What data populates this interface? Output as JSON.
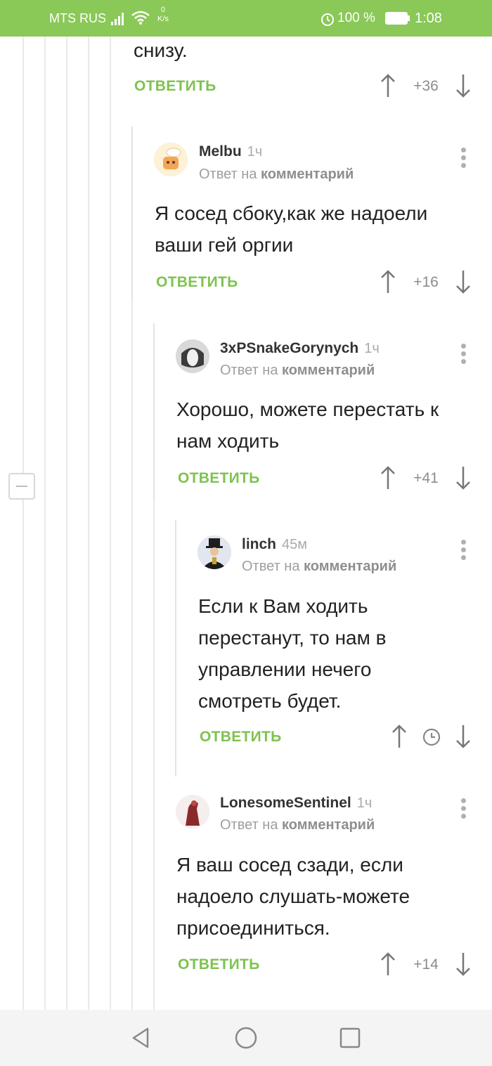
{
  "status_bar": {
    "carrier": "MTS RUS",
    "speed_value": "0",
    "speed_unit": "K/s",
    "battery": "100 %",
    "time": "1:08",
    "icons": [
      "signal-icon",
      "wifi-icon",
      "alarm-icon",
      "battery-icon"
    ]
  },
  "top_fragment": {
    "text_tail": "снизу.",
    "reply_label": "ОТВЕТИТЬ",
    "score": "+36"
  },
  "comments": [
    {
      "author": "Melbu",
      "time": "1ч",
      "reply_prefix": "Ответ на",
      "reply_target": "комментарий",
      "body": "Я сосед сбоку,как же надоели ваши гей оргии",
      "reply_label": "ОТВЕТИТЬ",
      "score": "+16"
    },
    {
      "author": "3xPSnakeGorynych",
      "time": "1ч",
      "reply_prefix": "Ответ на",
      "reply_target": "комментарий",
      "body": "Хорошо, можете перестать к нам ходить",
      "reply_label": "ОТВЕТИТЬ",
      "score": "+41"
    },
    {
      "author": "linch",
      "time": "45м",
      "reply_prefix": "Ответ на",
      "reply_target": "комментарий",
      "body": "Если к Вам ходить перестанут, то нам в управлении нечего смотреть будет.",
      "reply_label": "ОТВЕТИТЬ",
      "score": ""
    },
    {
      "author": "LonesomeSentinel",
      "time": "1ч",
      "reply_prefix": "Ответ на",
      "reply_target": "комментарий",
      "body": "Я ваш сосед сзади, если надоело слушать-можете присоединиться.",
      "reply_label": "ОТВЕТИТЬ",
      "score": "+14"
    }
  ],
  "colors": {
    "accent_green": "#7fc250",
    "status_bar": "#8ac858"
  },
  "nav_bar": {
    "icons": [
      "back-icon",
      "home-icon",
      "recents-icon"
    ]
  }
}
